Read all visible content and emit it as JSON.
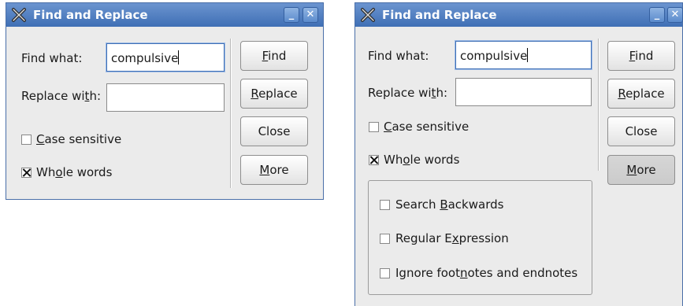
{
  "dialogs": [
    {
      "title": "Find and Replace",
      "find_label_pre": "Find what:",
      "find_value": "compulsive",
      "replace_label_pre": "Replace wi",
      "replace_label_ul": "t",
      "replace_label_post": "h:",
      "replace_value": "",
      "case_ul": "C",
      "case_rest": "ase sensitive",
      "case_checked": false,
      "whole_pre": "Wh",
      "whole_ul": "o",
      "whole_post": "le words",
      "whole_checked": true,
      "find_btn_ul": "F",
      "find_btn_rest": "ind",
      "replace_btn_ul": "R",
      "replace_btn_rest": "eplace",
      "close_btn": "Close",
      "more_btn_ul": "M",
      "more_btn_rest": "ore",
      "minimize_glyph": "_",
      "close_glyph": "✕"
    },
    {
      "title": "Find and Replace",
      "find_label_pre": "Find what:",
      "find_value": "compulsive",
      "replace_label_pre": "Replace wi",
      "replace_label_ul": "t",
      "replace_label_post": "h:",
      "replace_value": "",
      "case_ul": "C",
      "case_rest": "ase sensitive",
      "case_checked": false,
      "whole_pre": "Wh",
      "whole_ul": "o",
      "whole_post": "le words",
      "whole_checked": true,
      "find_btn_ul": "F",
      "find_btn_rest": "ind",
      "replace_btn_ul": "R",
      "replace_btn_rest": "eplace",
      "close_btn": "Close",
      "more_btn_ul": "M",
      "more_btn_rest": "ore",
      "more_pressed": true,
      "minimize_glyph": "_",
      "close_glyph": "✕",
      "options": {
        "backwards_pre": "Search ",
        "backwards_ul": "B",
        "backwards_post": "ackwards",
        "backwards_checked": false,
        "regex_pre": "Regular E",
        "regex_ul": "x",
        "regex_post": "pression",
        "regex_checked": false,
        "footnotes_pre": "Ignore foot",
        "footnotes_ul": "n",
        "footnotes_post": "otes and endnotes",
        "footnotes_checked": false
      }
    }
  ],
  "colors": {
    "titlebar": "#4f7fc0",
    "dialog_bg": "#ebebeb",
    "border": "#4a6fa8"
  },
  "icons": {
    "app": "x-app-icon",
    "minimize": "minimize-icon",
    "close": "close-icon"
  }
}
